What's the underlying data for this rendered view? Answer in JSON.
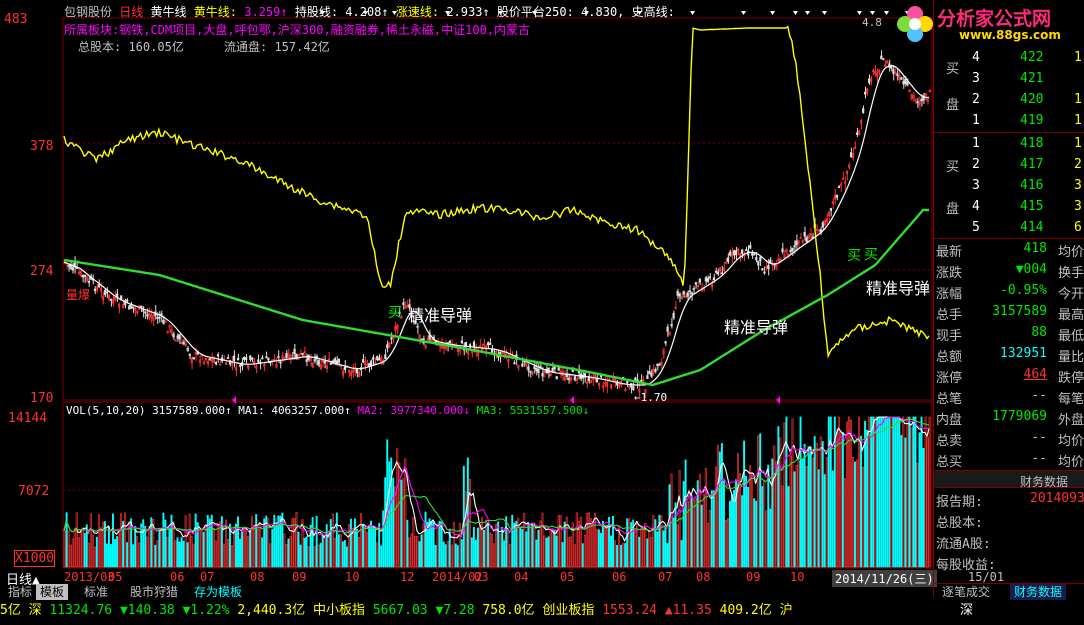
{
  "colors": {
    "up": "#ff3232",
    "down": "#00e600",
    "yellow": "#ffff00",
    "cyan": "#00ffff",
    "magenta": "#ff00ff",
    "green_ma": "#2fdc2f",
    "grid": "#800000",
    "white": "#ffffff",
    "gray": "#c0c0c0"
  },
  "header": {
    "stock_name": "包钢股份",
    "period": "日线",
    "ind1_label": "黄牛线",
    "ind2_label": "黄牛线:",
    "ind2_val": "3.259↑",
    "ind3": "持股线: 4.208↑",
    "ind4_label": "涨速线:",
    "ind4_val": "2.933↑",
    "ind5": "股价平台250: 4.830,",
    "ind6": "史高线:",
    "sector_prefix": "所属板块:",
    "sectors": "钢铁,CDM项目,大盘,呼包鄂,沪深300,融资融券,稀土永磁,中证100,内蒙古",
    "total_shares": "总股本: 160.05亿",
    "float_shares": "流通盘: 157.42亿",
    "top_right_val": "4.8"
  },
  "price_axis": [
    "483",
    "378",
    "274",
    "170"
  ],
  "vol_axis": [
    "14144",
    "7072",
    "X1000"
  ],
  "chart_labels": {
    "sell_wide": "量爆",
    "missile1": "精准导弹",
    "missile2": "精准导弹",
    "missile3": "精准导弹",
    "buy1": "买",
    "buy2": "买",
    "buy3": "买",
    "min_label": "1.70"
  },
  "volume_header": {
    "vol": "VOL(5,10,20) 3157589.000↑",
    "ma1": "MA1: 4063257.000↑",
    "ma2": "MA2: 3977340.000↓",
    "ma3": "MA3: 5531557.500↓"
  },
  "dates": [
    "2013/03",
    "05",
    "06",
    "07",
    "08",
    "09",
    "10",
    "12",
    "2014/02",
    "03",
    "04",
    "05",
    "06",
    "07",
    "08",
    "09",
    "10",
    "2014/11/26(三)",
    "15/01"
  ],
  "period_label": "日线▲",
  "bottom_tabs": [
    "指标",
    "模板",
    "标准",
    "股市狩猎",
    "存为模板"
  ],
  "logo": {
    "text": "分析家公式网",
    "url": "www.88gs.com"
  },
  "order_book": {
    "sell_label": [
      "买",
      "盘"
    ],
    "asks": [
      {
        "n": "4",
        "p": "422",
        "v": "1"
      },
      {
        "n": "3",
        "p": "421",
        "v": ""
      },
      {
        "n": "2",
        "p": "420",
        "v": "1"
      },
      {
        "n": "1",
        "p": "419",
        "v": "1"
      }
    ],
    "bid_label": [
      "买",
      "盘"
    ],
    "bids": [
      {
        "n": "1",
        "p": "418",
        "v": "1"
      },
      {
        "n": "2",
        "p": "417",
        "v": "2"
      },
      {
        "n": "3",
        "p": "416",
        "v": "3"
      },
      {
        "n": "4",
        "p": "415",
        "v": "3"
      },
      {
        "n": "5",
        "p": "414",
        "v": "6"
      }
    ]
  },
  "quote": [
    {
      "k": "最新",
      "v": "418",
      "r": "均价"
    },
    {
      "k": "涨跌",
      "v": "▼004",
      "r": "换手"
    },
    {
      "k": "涨幅",
      "v": "-0.95%",
      "r": "今开"
    },
    {
      "k": "总手",
      "v": "3157589",
      "r": "最高"
    },
    {
      "k": "现手",
      "v": "88",
      "r": "最低"
    },
    {
      "k": "总额",
      "v": "132951",
      "r": "量比"
    },
    {
      "k": "涨停",
      "v": "464",
      "r": "跌停"
    },
    {
      "k": "总笔",
      "v": "--",
      "r": "每笔"
    },
    {
      "k": "内盘",
      "v": "1779069",
      "r": "外盘"
    },
    {
      "k": "总卖",
      "v": "--",
      "r": "均价"
    },
    {
      "k": "总买",
      "v": "--",
      "r": "均价"
    }
  ],
  "finance": {
    "title": "财务数据",
    "rows": [
      {
        "k": "报告期:",
        "v": "2014093"
      },
      {
        "k": "总股本:",
        "v": ""
      },
      {
        "k": "流通A股:",
        "v": ""
      },
      {
        "k": "每股收益:",
        "v": ""
      }
    ]
  },
  "side_tabs": [
    "逐笔成交",
    "财务数据"
  ],
  "ticker": [
    {
      "t": "5亿 深 ",
      "c": "#ffff00"
    },
    {
      "t": "11324.76 ",
      "c": "#00e600"
    },
    {
      "t": "▼140.38 ",
      "c": "#00e600"
    },
    {
      "t": "▼1.22% ",
      "c": "#00e600"
    },
    {
      "t": "2,440.3亿 ",
      "c": "#ffff00"
    },
    {
      "t": "中小板指 ",
      "c": "#ffff00"
    },
    {
      "t": "5667.03 ",
      "c": "#00e600"
    },
    {
      "t": "▼7.28 ",
      "c": "#00e600"
    },
    {
      "t": "758.0亿 ",
      "c": "#ffff00"
    },
    {
      "t": "创业板指 ",
      "c": "#ffff00"
    },
    {
      "t": "1553.24 ",
      "c": "#ff3232"
    },
    {
      "t": "▲11.35 ",
      "c": "#ff3232"
    },
    {
      "t": "409.2亿 ",
      "c": "#ffff00"
    },
    {
      "t": "沪",
      "c": "#ffff00"
    }
  ],
  "ticker_right": "深"
}
